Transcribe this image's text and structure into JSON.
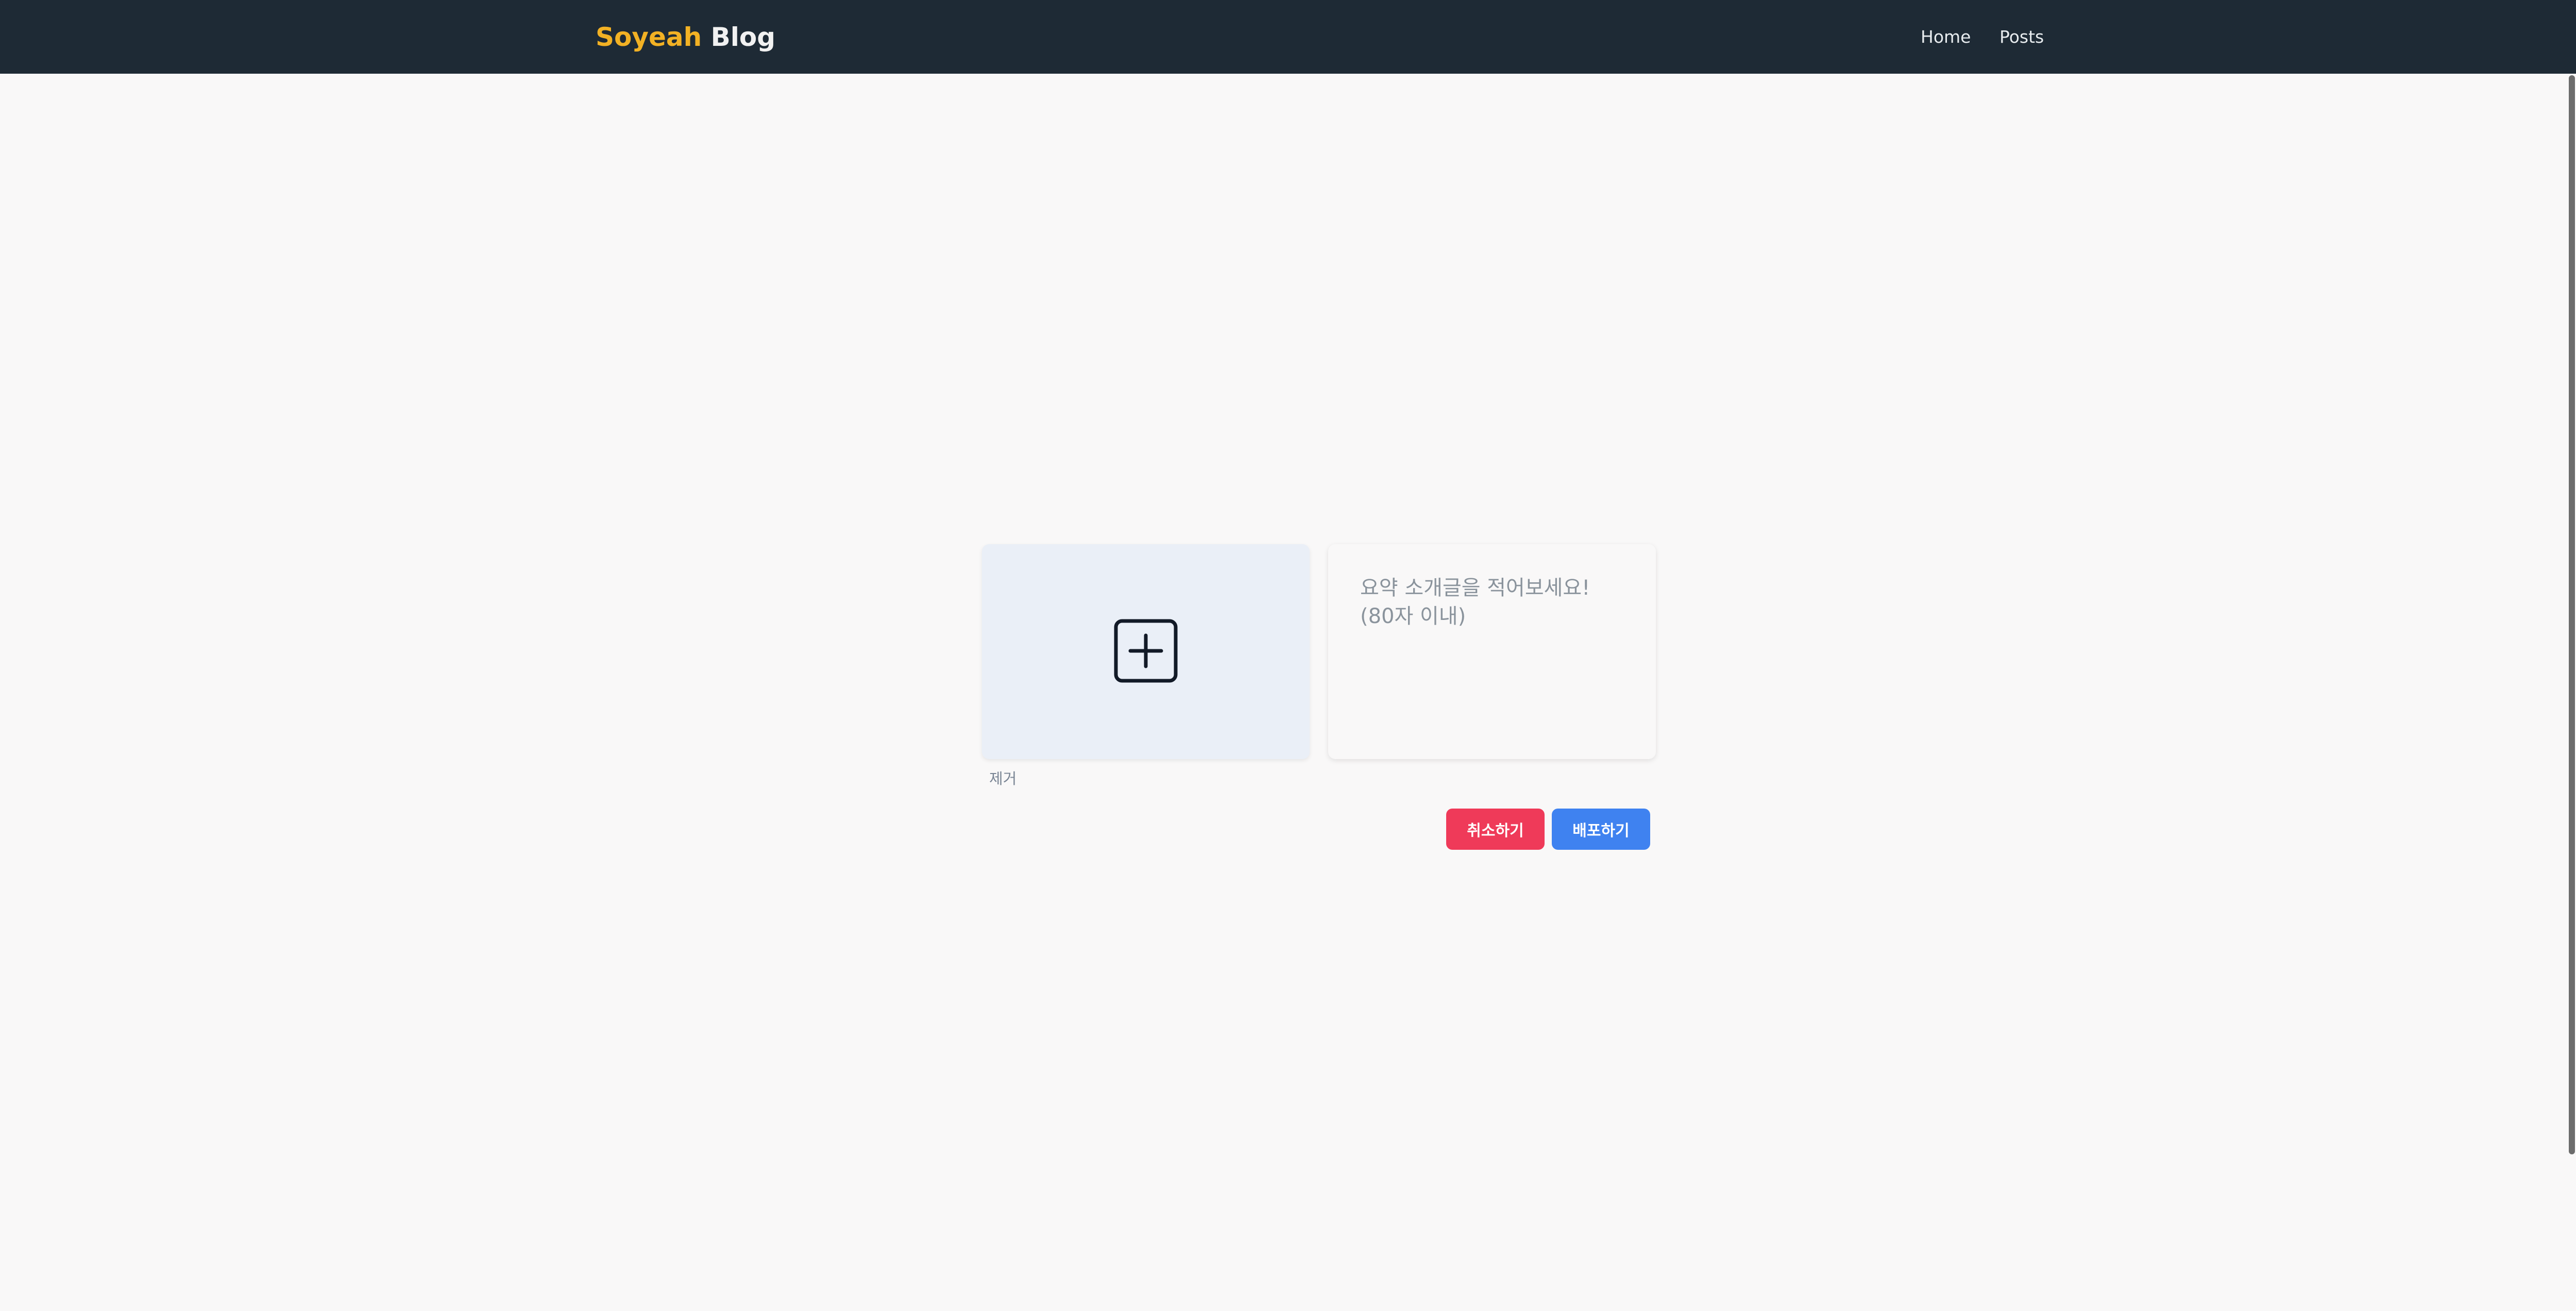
{
  "navbar": {
    "brand_part1": "Soyeah",
    "brand_part2": "Blog",
    "links": [
      {
        "label": "Home"
      },
      {
        "label": "Posts"
      }
    ]
  },
  "editor": {
    "thumbnail": {
      "icon": "plus-square-icon",
      "remove_label": "제거"
    },
    "summary": {
      "value": "",
      "placeholder": "요약 소개글을 적어보세요! (80자 이내)"
    },
    "actions": {
      "cancel_label": "취소하기",
      "deploy_label": "배포하기"
    }
  },
  "colors": {
    "navbar_bg": "#1e2a35",
    "brand_accent": "#f2b124",
    "cancel": "#ef3a59",
    "deploy": "#3f82f0",
    "thumbnail_bg": "#eaeff7",
    "page_bg": "#f9f8f8"
  }
}
